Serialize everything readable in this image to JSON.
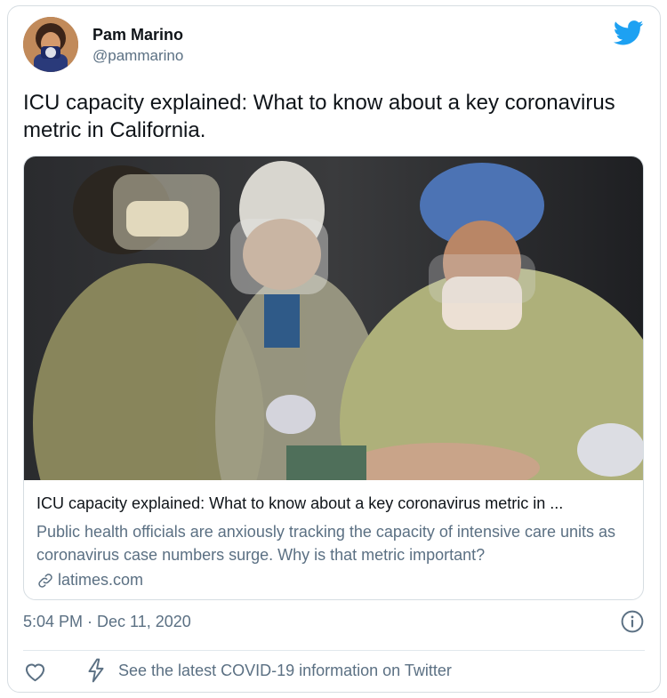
{
  "author": {
    "name": "Pam Marino",
    "handle": "@pammarino",
    "avatar": "avatar"
  },
  "tweet": {
    "text": "ICU capacity explained: What to know about a key coronavirus metric in California."
  },
  "link_card": {
    "image": "photo of health care workers in protective gear treating a patient",
    "title": "ICU capacity explained: What to know about a key coronavirus metric in ...",
    "description": "Public health officials are anxiously tracking the capacity of intensive care units as coronavirus case numbers surge. Why is that metric important?",
    "domain": "latimes.com",
    "domain_icon": "link-icon"
  },
  "footer": {
    "timestamp": "5:04 PM · Dec 11, 2020",
    "info_icon": "info-icon",
    "like_icon": "heart-icon",
    "bolt_icon": "lightning-bolt-icon",
    "covid_text": "See the latest COVID-19 information on Twitter"
  },
  "colors": {
    "twitter_blue": "#1da1f2",
    "text_primary": "#0f1419",
    "text_secondary": "#5b7083",
    "border": "#d6dde2"
  }
}
